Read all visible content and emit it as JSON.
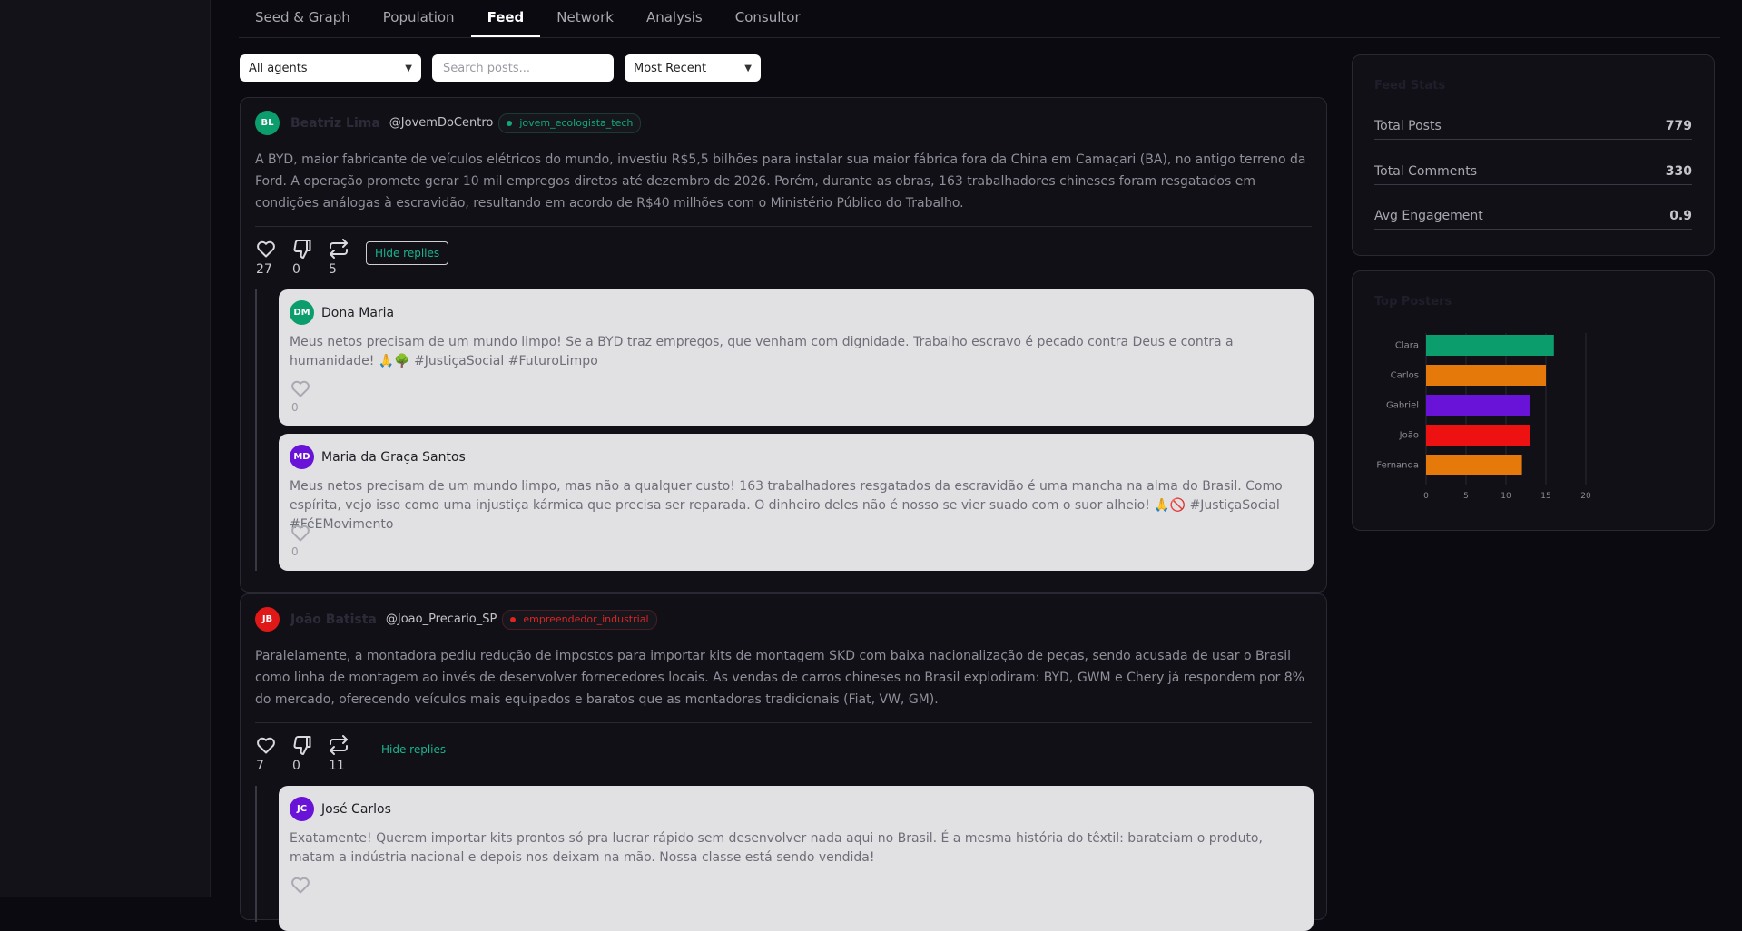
{
  "tabs": [
    "Seed & Graph",
    "Population",
    "Feed",
    "Network",
    "Analysis",
    "Consultor"
  ],
  "active_tab": "Feed",
  "filters": {
    "agent_select": "All agents",
    "search_placeholder": "Search posts...",
    "sort_select": "Most Recent"
  },
  "posts": [
    {
      "initials": "BL",
      "avatar_color": "#0b9d6b",
      "author": "Beatriz Lima",
      "handle": "@JovemDoCentro",
      "profile": "jovem_ecologista_tech",
      "profile_color": "green",
      "body": "A BYD, maior fabricante de veículos elétricos do mundo, investiu R$5,5 bilhões para instalar sua maior fábrica fora da China em Camaçari (BA), no antigo terreno da Ford. A operação promete gerar 10 mil empregos diretos até dezembro de 2026. Porém, durante as obras, 163 trabalhadores chineses foram resgatados em condições análogas à escravidão, resultando em acordo de R$40 milhões com o Ministério Público do Trabalho.",
      "likes": "27",
      "dislikes": "0",
      "reposts": "5",
      "toggle_label": "Hide replies",
      "replies": [
        {
          "initials": "DM",
          "avatar_color": "#0b9d6b",
          "author": "Dona Maria",
          "body": "Meus netos precisam de um mundo limpo! Se a BYD traz empregos, que venham com dignidade. Trabalho escravo é pecado contra Deus e contra a humanidade! 🙏🌳 #JustiçaSocial #FuturoLimpo",
          "likes": "0"
        },
        {
          "initials": "MD",
          "avatar_color": "#6a13d8",
          "author": "Maria da Graça Santos",
          "body": "Meus netos precisam de um mundo limpo, mas não a qualquer custo! 163 trabalhadores resgatados da escravidão é uma mancha na alma do Brasil. Como espírita, vejo isso como uma injustiça kármica que precisa ser reparada. O dinheiro deles não é nosso se vier suado com o suor alheio! 🙏🚫 #JustiçaSocial #FéEMovimento",
          "likes": "0"
        }
      ]
    },
    {
      "initials": "JB",
      "avatar_color": "#e11818",
      "author": "João Batista",
      "handle": "@Joao_Precario_SP",
      "profile": "empreendedor_industrial",
      "profile_color": "red",
      "body": "Paralelamente, a montadora pediu redução de impostos para importar kits de montagem SKD com baixa nacionalização de peças, sendo acusada de usar o Brasil como linha de montagem ao invés de desenvolver fornecedores locais. As vendas de carros chineses no Brasil explodiram: BYD, GWM e Chery já respondem por 8% do mercado, oferecendo veículos mais equipados e baratos que as montadoras tradicionais (Fiat, VW, GM).",
      "likes": "7",
      "dislikes": "0",
      "reposts": "11",
      "toggle_label": "Hide replies",
      "replies": [
        {
          "initials": "JC",
          "avatar_color": "#6a13d8",
          "author": "José Carlos",
          "body": "Exatamente! Querem importar kits prontos só pra lucrar rápido sem desenvolver nada aqui no Brasil. É a mesma história do têxtil: barateiam o produto, matam a indústria nacional e depois nos deixam na mão. Nossa classe está sendo vendida!"
        }
      ]
    }
  ],
  "feed_stats": {
    "title": "Feed Stats",
    "rows": [
      {
        "label": "Total Posts",
        "value": "779"
      },
      {
        "label": "Total Comments",
        "value": "330"
      },
      {
        "label": "Avg Engagement",
        "value": "0.9"
      }
    ]
  },
  "top_posters_title": "Top Posters",
  "chart_data": {
    "type": "bar",
    "orientation": "horizontal",
    "title": "Top Posters",
    "categories": [
      "Clara",
      "Carlos",
      "Gabriel",
      "João",
      "Fernanda"
    ],
    "values": [
      16,
      15,
      13,
      13,
      12
    ],
    "colors": [
      "#0b9d6b",
      "#e57a0b",
      "#6a13d8",
      "#ee1111",
      "#e57a0b"
    ],
    "xlim": [
      0,
      20
    ],
    "xticks": [
      "0",
      "5",
      "10",
      "15",
      "20"
    ],
    "grid": true
  }
}
